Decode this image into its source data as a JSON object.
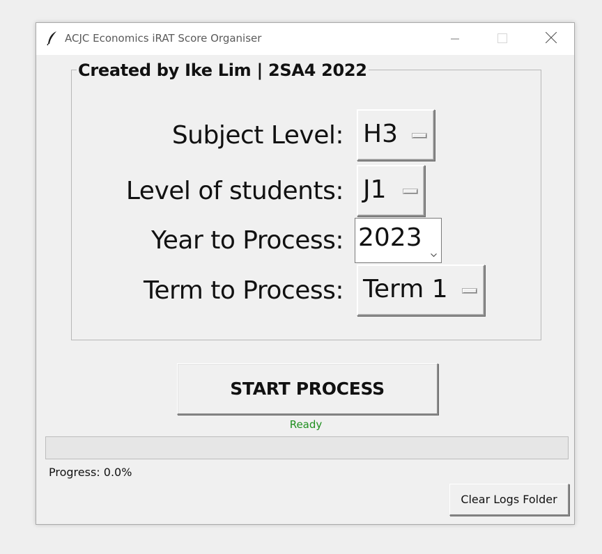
{
  "window": {
    "title": "ACJC Economics iRAT Score Organiser",
    "icon": "feather-icon",
    "controls": [
      "minimize-icon",
      "maximize-icon",
      "close-icon"
    ]
  },
  "frame": {
    "title": "Created by Ike Lim | 2SA4 2022"
  },
  "fields": {
    "subject_level": {
      "label": "Subject Level:",
      "value": "H3"
    },
    "student_level": {
      "label": "Level of students:",
      "value": "J1"
    },
    "year": {
      "label": "Year to Process:",
      "value": "2023"
    },
    "term": {
      "label": "Term to Process:",
      "value": "Term 1"
    }
  },
  "actions": {
    "start_label": "START PROCESS",
    "clear_logs_label": "Clear Logs Folder"
  },
  "status": {
    "text": "Ready",
    "color": "#1e8f1e"
  },
  "progress": {
    "label": "Progress: 0.0%",
    "fraction": 0.0
  }
}
